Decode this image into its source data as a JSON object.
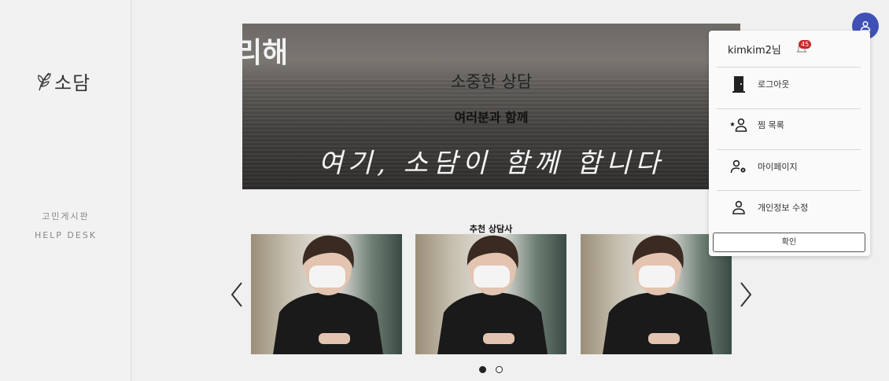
{
  "sidebar": {
    "logo_text": "소담",
    "nav": [
      {
        "label": "고민게시판"
      },
      {
        "label": "HELP DESK"
      }
    ]
  },
  "banner": {
    "corner_text": "리해",
    "line1": "소중한 상담",
    "line2": "여러분과 함께",
    "line3": "여기, 소담이 함께 합니다"
  },
  "recommend": {
    "title": "추천 상담사",
    "cards": [
      {
        "icon": "counselor-photo"
      },
      {
        "icon": "counselor-photo"
      },
      {
        "icon": "counselor-photo"
      }
    ],
    "pages": 2,
    "active_page": 1
  },
  "account_menu": {
    "username": "kimkim2님",
    "notification_count": "45",
    "items": [
      {
        "label": "로그아웃",
        "icon": "door-icon"
      },
      {
        "label": "찜 목록",
        "icon": "star-person-icon"
      },
      {
        "label": "마이페이지",
        "icon": "person-gear-icon"
      },
      {
        "label": "개인정보 수정",
        "icon": "person-icon"
      }
    ],
    "confirm_label": "확인"
  },
  "colors": {
    "accent": "#3f51b5",
    "badge": "#c62828",
    "background": "#f0f0f0"
  }
}
